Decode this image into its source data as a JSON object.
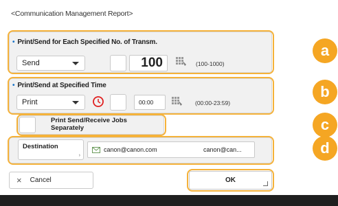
{
  "header": {
    "title": "<Communication Management Report>"
  },
  "section_a": {
    "title": "Print/Send for Each Specified No. of Transm.",
    "dropdown_value": "Send",
    "number_value": "100",
    "range": "(100-1000)",
    "badge": "a"
  },
  "section_b": {
    "title": "Print/Send at Specified Time",
    "dropdown_value": "Print",
    "time_value": "00:00",
    "range": "(00:00-23:59)",
    "badge": "b"
  },
  "section_c": {
    "label": "Print Send/Receive Jobs Separately",
    "badge": "c"
  },
  "section_d": {
    "destination_label": "Destination",
    "dest_address": "canon@canon.com",
    "dest_name": "canon@can...",
    "badge": "d"
  },
  "footer": {
    "cancel_label": "Cancel",
    "ok_label": "OK"
  },
  "colors": {
    "accent": "#f5a623",
    "highlight": "#f5b23a",
    "timer": "#e02020",
    "bar": "#1f1f1f"
  }
}
